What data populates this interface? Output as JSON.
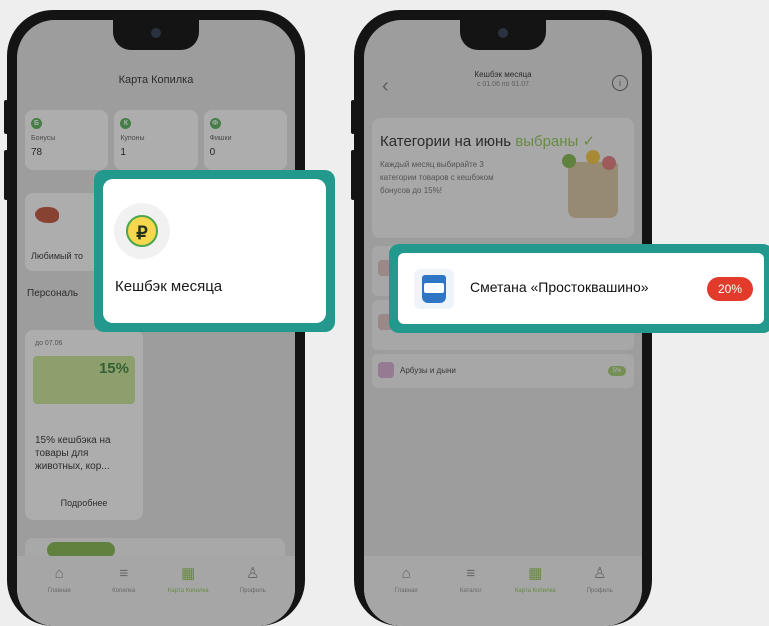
{
  "left_phone": {
    "title": "Карта Копилка",
    "tiles": [
      {
        "icon_letter": "Б",
        "label": "Бонусы",
        "value": "78"
      },
      {
        "icon_letter": "К",
        "label": "Купоны",
        "value": "1"
      },
      {
        "icon_letter": "Ф",
        "label": "Фишки",
        "value": "0"
      }
    ],
    "favorite_label": "Любимый то",
    "section_label": "Персональ",
    "promo": {
      "date": "до 07.06",
      "percent": "15%",
      "description": "15% кешбэка на товары для животных, кор...",
      "more": "Подробнее"
    },
    "nav": [
      {
        "icon": "home-icon",
        "glyph": "⌂",
        "label": "Главная",
        "active": false
      },
      {
        "icon": "catalog-icon",
        "glyph": "≡",
        "label": "Копилка",
        "active": false
      },
      {
        "icon": "qr-icon",
        "glyph": "▦",
        "label": "Карта Копилка",
        "active": true
      },
      {
        "icon": "profile-icon",
        "glyph": "♙",
        "label": "Профиль",
        "active": false
      }
    ]
  },
  "right_phone": {
    "header_title": "Кешбэк месяца",
    "header_subtitle": "с 01.06 по 01.07",
    "hero_title": "Категории на июнь",
    "hero_title_accent": "выбраны ✓",
    "hero_text": "Каждый месяц выбирайте 3 категории товаров с кешбэком бонусов до 15%!",
    "rows": [
      {
        "label": "",
        "badge": ""
      },
      {
        "label": "",
        "badge": ""
      },
      {
        "label": "Арбузы и дыни",
        "badge": "5%"
      }
    ],
    "nav": [
      {
        "icon": "home-icon",
        "glyph": "⌂",
        "label": "Главная",
        "active": false
      },
      {
        "icon": "catalog-icon",
        "glyph": "≡",
        "label": "Каталог",
        "active": false
      },
      {
        "icon": "qr-icon",
        "glyph": "▦",
        "label": "Карта Копилка",
        "active": true
      },
      {
        "icon": "profile-icon",
        "glyph": "♙",
        "label": "Профиль",
        "active": false
      }
    ]
  },
  "callout_cashback": {
    "coin_symbol": "₽",
    "label": "Кешбэк месяца"
  },
  "callout_product": {
    "name": "Сметана «Простоквашино»",
    "badge": "20%"
  },
  "colors": {
    "accent_teal": "#23998e",
    "accent_green": "#8bc34a",
    "badge_red": "#e23b2b"
  }
}
